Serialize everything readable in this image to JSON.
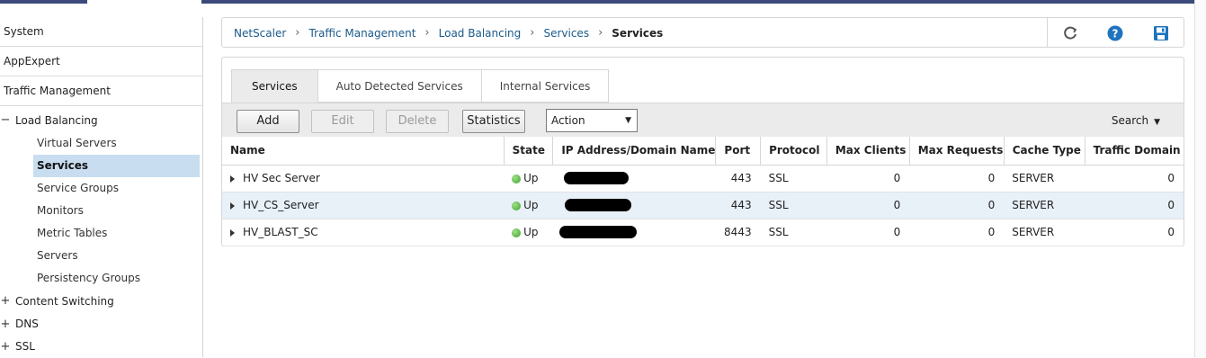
{
  "sidebar": {
    "top_items": [
      "System",
      "AppExpert",
      "Traffic Management"
    ],
    "group_load_balancing": {
      "toggle": "−",
      "label": "Load Balancing"
    },
    "sub_items": [
      "Virtual Servers",
      "Services",
      "Service Groups",
      "Monitors",
      "Metric Tables",
      "Servers",
      "Persistency Groups"
    ],
    "groups_below": [
      {
        "toggle": "+",
        "label": "Content Switching"
      },
      {
        "toggle": "+",
        "label": "DNS"
      },
      {
        "toggle": "+",
        "label": "SSL"
      }
    ]
  },
  "breadcrumb": [
    "NetScaler",
    "Traffic Management",
    "Load Balancing",
    "Services"
  ],
  "breadcrumb_current": "Services",
  "tools": {
    "refresh_icon": "refresh-icon",
    "help_icon": "help-icon",
    "save_icon": "save-icon"
  },
  "tabs": [
    "Services",
    "Auto Detected Services",
    "Internal Services"
  ],
  "toolbar": {
    "add": "Add",
    "edit": "Edit",
    "delete": "Delete",
    "statistics": "Statistics",
    "action": "Action",
    "search": "Search"
  },
  "table": {
    "headers": [
      "Name",
      "State",
      "IP Address/Domain Name",
      "Port",
      "Protocol",
      "Max Clients",
      "Max Requests",
      "Cache Type",
      "Traffic Domain"
    ],
    "rows": [
      {
        "name": "HV Sec Server",
        "state": "Up",
        "port": "443",
        "protocol": "SSL",
        "max_clients": "0",
        "max_requests": "0",
        "cache_type": "SERVER",
        "traffic_domain": "0"
      },
      {
        "name": "HV_CS_Server",
        "state": "Up",
        "port": "443",
        "protocol": "SSL",
        "max_clients": "0",
        "max_requests": "0",
        "cache_type": "SERVER",
        "traffic_domain": "0"
      },
      {
        "name": "HV_BLAST_SC",
        "state": "Up",
        "port": "8443",
        "protocol": "SSL",
        "max_clients": "0",
        "max_requests": "0",
        "cache_type": "SERVER",
        "traffic_domain": "0"
      }
    ]
  },
  "colors": {
    "accent": "#3b4a7a",
    "link": "#1a5a8a",
    "selected": "#c9ddf0",
    "status_up": "#3aa327",
    "help_icon": "#1e73be",
    "save_icon": "#1e73be"
  }
}
